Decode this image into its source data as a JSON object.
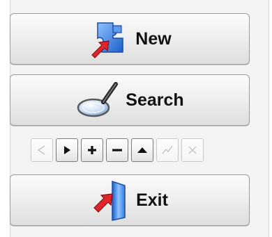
{
  "buttons": {
    "new": {
      "label": "New",
      "icon": "new-record-icon"
    },
    "search": {
      "label": "Search",
      "icon": "magnifier-icon"
    },
    "exit": {
      "label": "Exit",
      "icon": "exit-door-icon"
    }
  },
  "navigator": [
    {
      "name": "nav-prior-button",
      "icon": "triangle-left-icon",
      "enabled": false
    },
    {
      "name": "nav-next-button",
      "icon": "triangle-right-icon",
      "enabled": true
    },
    {
      "name": "nav-insert-button",
      "icon": "plus-icon",
      "enabled": true
    },
    {
      "name": "nav-delete-button",
      "icon": "minus-icon",
      "enabled": true
    },
    {
      "name": "nav-edit-button",
      "icon": "triangle-up-icon",
      "enabled": true
    },
    {
      "name": "nav-post-button",
      "icon": "checkmark-icon",
      "enabled": false
    },
    {
      "name": "nav-cancel-button",
      "icon": "cross-icon",
      "enabled": false
    }
  ],
  "colors": {
    "icon_blue": "#2f7fe0",
    "icon_red": "#e0262a",
    "button_border": "#9c9c9c"
  }
}
